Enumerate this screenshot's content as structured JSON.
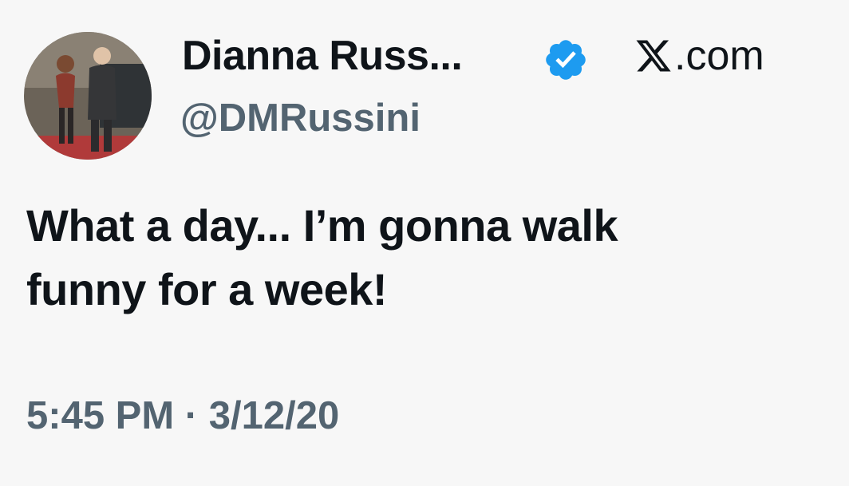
{
  "author": {
    "display_name": "Dianna Russ...",
    "handle": "@DMRussini",
    "verified_icon": "verified-badge-icon",
    "avatar_description_icon": "profile-photo"
  },
  "site": {
    "label": ".com",
    "logo_icon": "x-logo-icon"
  },
  "tweet": {
    "text": "What a day... I’m gonna walk\nfunny for a week!",
    "timestamp": "5:45 PM · 3/12/20"
  },
  "colors": {
    "text_primary": "#0f1419",
    "text_secondary": "#536471",
    "verified_blue": "#1d9bf0",
    "background": "#f7f7f7"
  }
}
